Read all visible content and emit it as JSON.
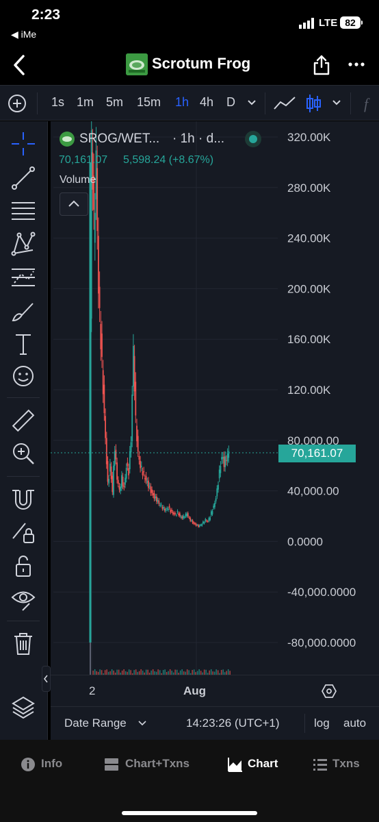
{
  "status_bar": {
    "time": "2:23",
    "back_app": "◀ iMe",
    "network": "LTE",
    "battery": "82"
  },
  "header": {
    "title": "Scrotum Frog"
  },
  "timeframes": {
    "items": [
      "1s",
      "1m",
      "5m",
      "15m",
      "1h",
      "4h",
      "D"
    ],
    "active": "1h"
  },
  "legend": {
    "symbol": "SROG/WET...",
    "interval": "· 1h · d...",
    "price": "70,161.07",
    "change": "5,598.24 (+8.67%)",
    "volume_label": "Volume"
  },
  "price_axis": {
    "labels": [
      "320.00K",
      "280.00K",
      "240.00K",
      "200.00K",
      "160.00K",
      "120.00K",
      "80,000.00",
      "40,000.00",
      "0.0000",
      "-40,000.0000",
      "-80,000.0000"
    ],
    "current_price_label": "70,161.07"
  },
  "time_axis": {
    "labels": [
      "2",
      "Aug"
    ]
  },
  "bottom_bar": {
    "date_range": "Date Range",
    "time": "14:23:26 (UTC+1)",
    "log": "log",
    "auto": "auto"
  },
  "nav": {
    "info": "Info",
    "chart_txns": "Chart+Txns",
    "chart": "Chart",
    "txns": "Txns"
  },
  "colors": {
    "up": "#26a69a",
    "down": "#ef5350",
    "accent": "#2962ff",
    "bg": "#161a23"
  },
  "chart_data": {
    "type": "line",
    "title": "SROG/WET...",
    "xlabel": "",
    "ylabel": "",
    "ylim": [
      -80000,
      320000
    ],
    "yticks": [
      320000,
      280000,
      240000,
      200000,
      160000,
      120000,
      80000,
      40000,
      0,
      -40000,
      -80000
    ],
    "x_tick_labels": [
      "2",
      "Aug"
    ],
    "current_price": 70161.07,
    "series": [
      {
        "x": [
          0,
          1,
          2,
          3,
          4,
          5,
          6,
          7,
          8,
          9,
          10,
          11,
          12,
          13,
          14,
          15,
          16,
          17,
          18,
          19,
          20,
          21,
          22,
          23,
          24,
          25,
          26,
          27,
          28,
          29,
          30,
          31,
          32,
          33,
          34,
          35,
          36,
          37,
          38,
          39,
          40,
          41,
          42,
          43,
          44,
          45,
          46,
          47,
          48,
          49,
          50,
          51,
          52,
          53,
          54,
          55,
          56,
          57,
          58,
          59,
          60
        ],
        "y": [
          5000,
          320000,
          250000,
          300000,
          200000,
          160000,
          120000,
          80000,
          45000,
          60000,
          40000,
          75000,
          50000,
          40000,
          50000,
          42000,
          60000,
          55000,
          80000,
          150000,
          95000,
          70000,
          60000,
          55000,
          50000,
          46000,
          42000,
          38000,
          35000,
          33000,
          30000,
          28000,
          26000,
          25000,
          27000,
          24000,
          22000,
          21000,
          23000,
          20000,
          19000,
          20000,
          22000,
          18000,
          16000,
          14000,
          13000,
          12000,
          13000,
          15000,
          17000,
          16000,
          20000,
          25000,
          30000,
          40000,
          55000,
          68000,
          62000,
          66000,
          70161
        ]
      }
    ]
  }
}
